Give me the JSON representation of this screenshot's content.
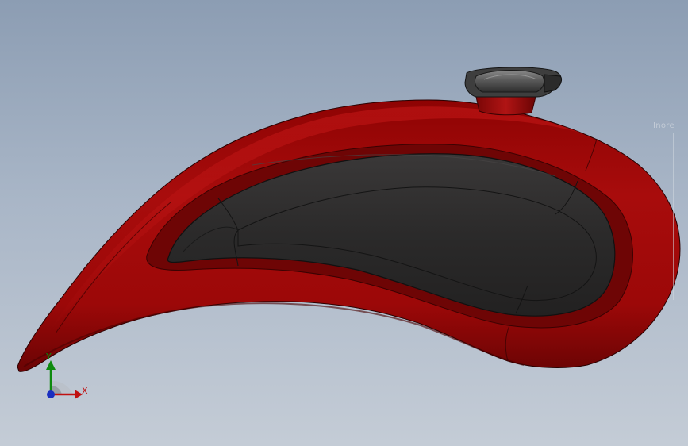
{
  "viewport": {
    "background_top": "#8c9db3",
    "background_bottom": "#c4ccd6",
    "model": {
      "body_color": "#a00a0a",
      "body_shadow_color": "#5a0303",
      "panel_color": "#2b2a2a",
      "cap_color": "#4a4a4a"
    },
    "faint_label": "Inore",
    "triad": {
      "x_label": "X",
      "y_label": "Y",
      "x_color": "#c01010",
      "y_color": "#0e8a0e",
      "z_color": "#1a2fc0"
    }
  }
}
